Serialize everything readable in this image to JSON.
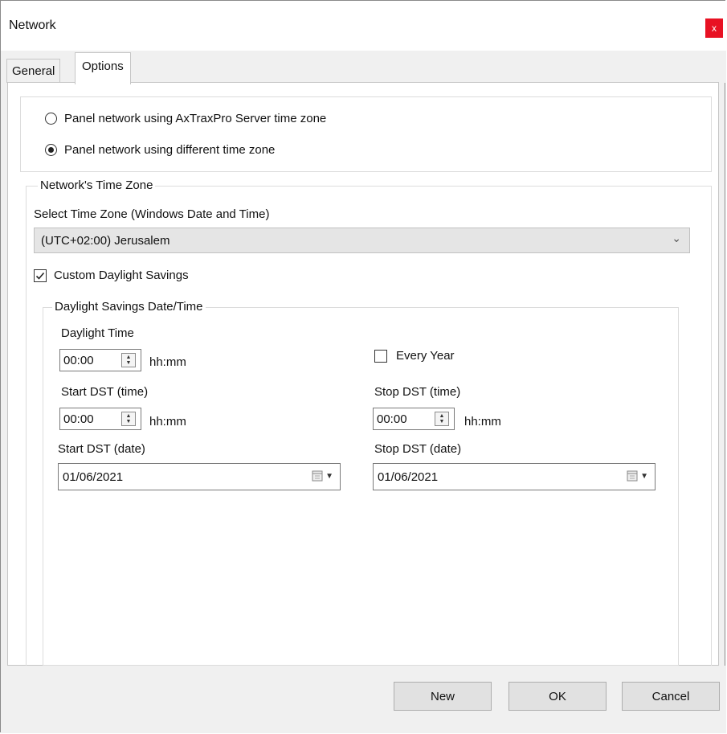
{
  "window": {
    "title": "Network",
    "close_glyph": "x"
  },
  "tabs": [
    {
      "label": "General",
      "selected": false
    },
    {
      "label": "Options",
      "selected": true
    }
  ],
  "radio_options": [
    {
      "label": "Panel network using AxTraxPro Server time zone",
      "checked": false
    },
    {
      "label": "Panel network using different time zone",
      "checked": true
    }
  ],
  "time_zone_group": {
    "title": "Network's Time Zone",
    "select_label": "Select Time Zone (Windows Date and Time)",
    "selected_zone": "(UTC+02:00) Jerusalem",
    "custom_dst_label": "Custom Daylight Savings",
    "custom_dst_checked": true
  },
  "dst_group": {
    "title": "Daylight Savings Date/Time",
    "daylight_time_label": "Daylight Time",
    "daylight_time_value": "00:00",
    "unit_label": "hh:mm",
    "every_year_label": "Every Year",
    "every_year_checked": false,
    "start_time_label": "Start DST (time)",
    "start_time_value": "00:00",
    "stop_time_label": "Stop DST (time)",
    "stop_time_value": "00:00",
    "start_date_label": "Start DST (date)",
    "start_date_value": "01/06/2021",
    "stop_date_label": "Stop DST (date)",
    "stop_date_value": "01/06/2021"
  },
  "footer": {
    "new_label": "New",
    "ok_label": "OK",
    "cancel_label": "Cancel"
  },
  "colors": {
    "close_button": "#e81123",
    "window_background": "#f0f0f0",
    "panel_background": "#ffffff"
  }
}
